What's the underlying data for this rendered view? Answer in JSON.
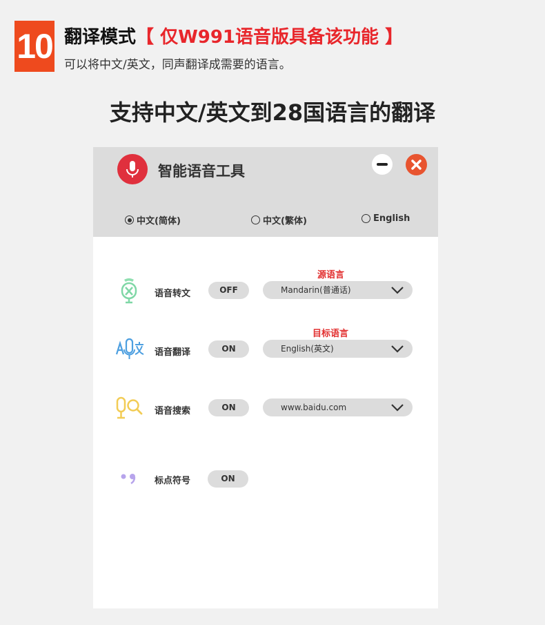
{
  "feature": {
    "number": "10",
    "title": "翻译模式",
    "highlight": "【 仅W991语音版具备该功能 】",
    "subtitle": "可以将中文/英文，同声翻译成需要的语言。"
  },
  "headline": "支持中文/英文到28国语言的翻译",
  "window": {
    "title": "智能语音工具",
    "languages": [
      {
        "label": "中文(简体)",
        "selected": true
      },
      {
        "label": "中文(繁体)",
        "selected": false
      },
      {
        "label": "English",
        "selected": false
      }
    ],
    "rows": [
      {
        "label": "语音转文",
        "icon": "speech-to-text-icon",
        "toggle": "OFF",
        "dropdown": "Mandarin(普通话)",
        "tag": "源语言"
      },
      {
        "label": "语音翻译",
        "icon": "translate-icon",
        "toggle": "ON",
        "dropdown": "English(英文)",
        "tag": "目标语言"
      },
      {
        "label": "语音搜索",
        "icon": "voice-search-icon",
        "toggle": "ON",
        "dropdown": "www.baidu.com"
      },
      {
        "label": "标点符号",
        "icon": "punctuation-icon",
        "toggle": "ON"
      }
    ]
  },
  "colors": {
    "badge": "#ee4a1e",
    "highlight": "#e8262b",
    "mic": "#e0303d",
    "close": "#e8542f",
    "tag": "#e23030"
  }
}
